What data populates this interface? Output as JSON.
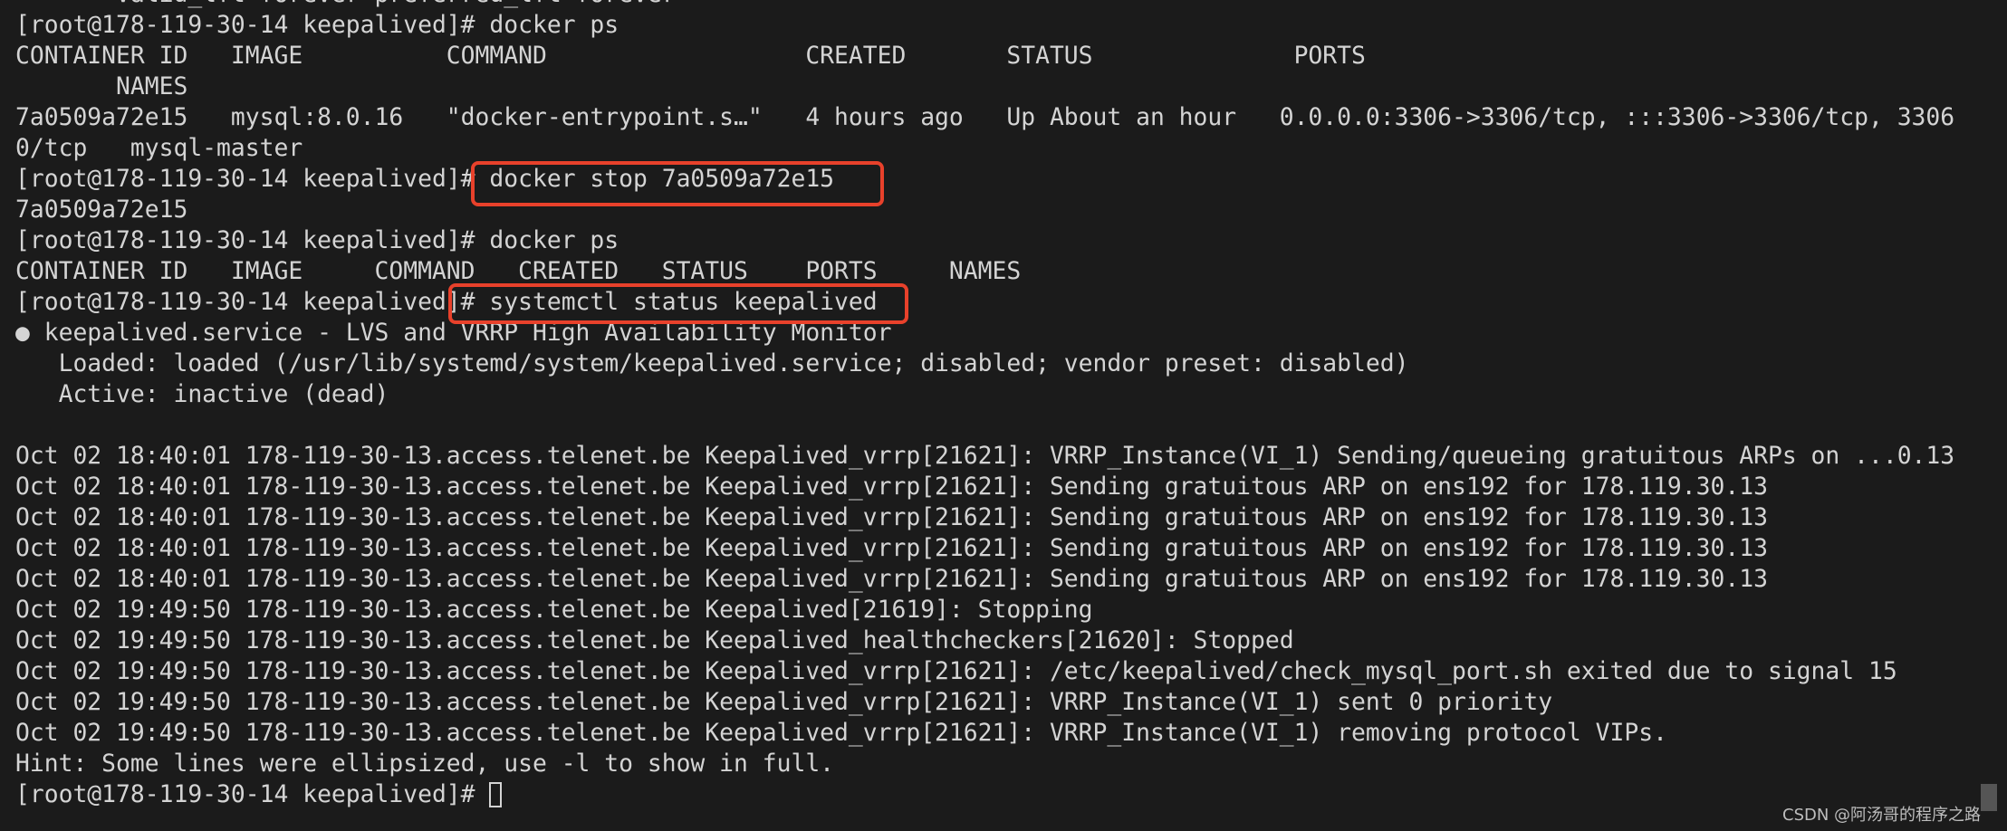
{
  "terminal": {
    "lines": [
      "       valid_lft forever preferred_lft forever",
      "[root@178-119-30-14 keepalived]# docker ps",
      "CONTAINER ID   IMAGE          COMMAND                  CREATED       STATUS              PORTS",
      "       NAMES",
      "7a0509a72e15   mysql:8.0.16   \"docker-entrypoint.s…\"   4 hours ago   Up About an hour   0.0.0.0:3306->3306/tcp, :::3306->3306/tcp, 3306",
      "0/tcp   mysql-master",
      "[root@178-119-30-14 keepalived]# docker stop 7a0509a72e15",
      "7a0509a72e15",
      "[root@178-119-30-14 keepalived]# docker ps",
      "CONTAINER ID   IMAGE     COMMAND   CREATED   STATUS    PORTS     NAMES",
      "[root@178-119-30-14 keepalived]# systemctl status keepalived",
      "● keepalived.service - LVS and VRRP High Availability Monitor",
      "   Loaded: loaded (/usr/lib/systemd/system/keepalived.service; disabled; vendor preset: disabled)",
      "   Active: inactive (dead)",
      "",
      "Oct 02 18:40:01 178-119-30-13.access.telenet.be Keepalived_vrrp[21621]: VRRP_Instance(VI_1) Sending/queueing gratuitous ARPs on ...0.13",
      "Oct 02 18:40:01 178-119-30-13.access.telenet.be Keepalived_vrrp[21621]: Sending gratuitous ARP on ens192 for 178.119.30.13",
      "Oct 02 18:40:01 178-119-30-13.access.telenet.be Keepalived_vrrp[21621]: Sending gratuitous ARP on ens192 for 178.119.30.13",
      "Oct 02 18:40:01 178-119-30-13.access.telenet.be Keepalived_vrrp[21621]: Sending gratuitous ARP on ens192 for 178.119.30.13",
      "Oct 02 18:40:01 178-119-30-13.access.telenet.be Keepalived_vrrp[21621]: Sending gratuitous ARP on ens192 for 178.119.30.13",
      "Oct 02 19:49:50 178-119-30-13.access.telenet.be Keepalived[21619]: Stopping",
      "Oct 02 19:49:50 178-119-30-13.access.telenet.be Keepalived_healthcheckers[21620]: Stopped",
      "Oct 02 19:49:50 178-119-30-13.access.telenet.be Keepalived_vrrp[21621]: /etc/keepalived/check_mysql_port.sh exited due to signal 15",
      "Oct 02 19:49:50 178-119-30-13.access.telenet.be Keepalived_vrrp[21621]: VRRP_Instance(VI_1) sent 0 priority",
      "Oct 02 19:49:50 178-119-30-13.access.telenet.be Keepalived_vrrp[21621]: VRRP_Instance(VI_1) removing protocol VIPs.",
      "Hint: Some lines were ellipsized, use -l to show in full."
    ],
    "prompt": "[root@178-119-30-14 keepalived]# "
  },
  "highlight_color": "#e8412b",
  "watermark": "CSDN @阿汤哥的程序之路"
}
